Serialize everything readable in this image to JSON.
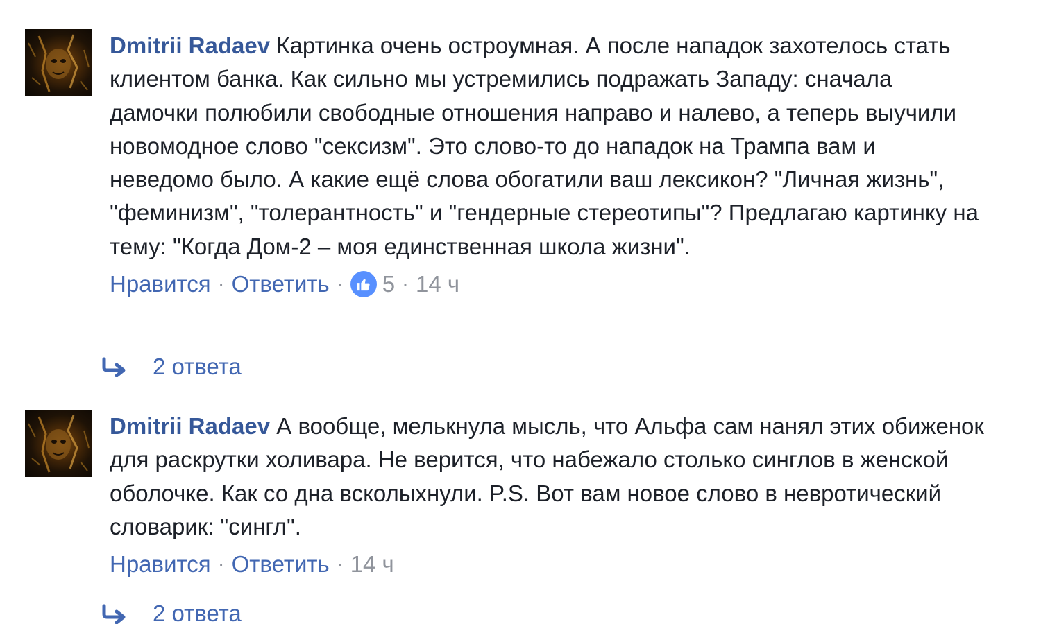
{
  "comments": [
    {
      "author": "Dmitrii Radaev",
      "text": "Картинка очень остроумная. А после нападок захотелось стать клиентом банка. Как сильно мы устремились подражать Западу: сначала дамочки полюбили свободные отношения направо и налево, а теперь выучили новомодное слово \"сексизм\". Это слово-то до нападок на Трампа вам и неведомо было. А какие ещё слова обогатили ваш лексикон? \"Личная жизнь\", \"феминизм\", \"толерантность\" и \"гендерные стереотипы\"? Предлагаю картинку на тему: \"Когда Дом-2 – моя единственная школа жизни\".",
      "like_label": "Нравится",
      "reply_label": "Ответить",
      "reactions_count": "5",
      "reaction_icon": "thumbs-up-icon",
      "time": "14 ч",
      "replies_label": "2 ответа"
    },
    {
      "author": "Dmitrii Radaev",
      "text": "А вообще, мелькнула мысль, что Альфа сам нанял этих обиженок для раскрутки холивара. Не верится, что набежало столько синглов в женской оболочке. Как со дна всколыхнули. P.S. Вот вам новое слово в невротический словарик: \"сингл\".",
      "like_label": "Нравится",
      "reply_label": "Ответить",
      "time": "14 ч",
      "replies_label": "2 ответа"
    }
  ],
  "colors": {
    "author": "#365899",
    "link": "#4267b2",
    "text": "#1d2129",
    "meta": "#90949c",
    "like_badge": "#5890ff"
  }
}
